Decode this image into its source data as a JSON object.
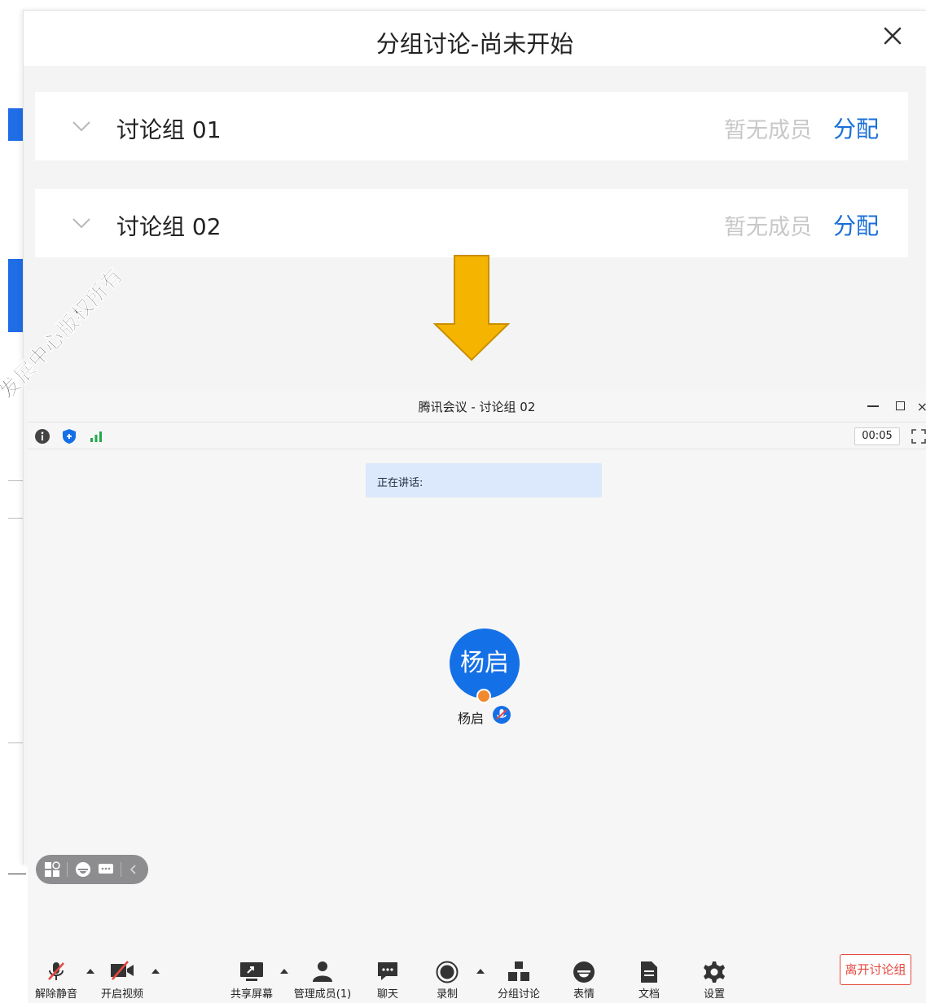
{
  "dialog": {
    "title": "分组讨论-尚未开始",
    "groups": [
      {
        "name": "讨论组 01",
        "status": "暂无成员",
        "action": "分配"
      },
      {
        "name": "讨论组 02",
        "status": "暂无成员",
        "action": "分配"
      }
    ]
  },
  "watermark": "发展中心版权所有",
  "meeting": {
    "title": "腾讯会议 - 讨论组 02",
    "timer": "00:05",
    "speaking_label": "正在讲话:",
    "participant": {
      "avatar_text": "杨启",
      "name": "杨启"
    },
    "toolbar": {
      "unmute": "解除静音",
      "start_video": "开启视频",
      "share_screen": "共享屏幕",
      "manage_members": "管理成员(1)",
      "chat": "聊天",
      "record": "录制",
      "breakout": "分组讨论",
      "reactions": "表情",
      "docs": "文档",
      "settings": "设置",
      "leave": "离开讨论组"
    }
  },
  "colors": {
    "accent": "#1a6fd8",
    "avatar": "#1470e6",
    "arrow": "#f5b400",
    "leave": "#e5483f",
    "speaking_bg": "#dce8fb"
  }
}
